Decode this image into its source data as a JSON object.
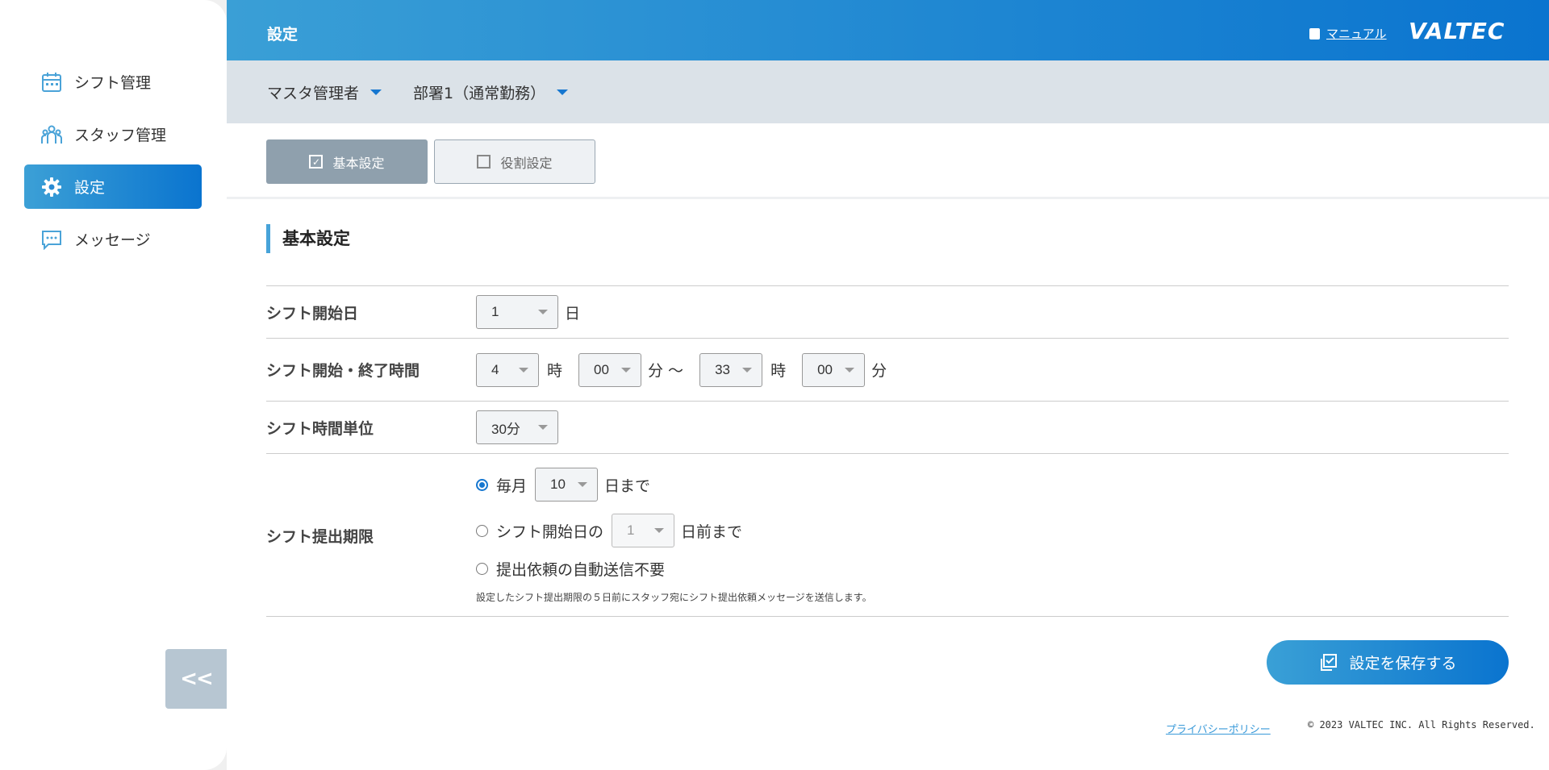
{
  "sidebar": {
    "items": [
      {
        "label": "シフト管理",
        "icon": "calendar-icon",
        "active": false
      },
      {
        "label": "スタッフ管理",
        "icon": "staff-icon",
        "active": false
      },
      {
        "label": "設定",
        "icon": "gear-icon",
        "active": true
      },
      {
        "label": "メッセージ",
        "icon": "message-icon",
        "active": false
      }
    ],
    "collapse_label": "<<"
  },
  "header": {
    "title": "設定",
    "manual_label": "マニュアル",
    "logo": "VALTEC"
  },
  "subheader": {
    "role_select": "マスタ管理者",
    "department_select": "部署1（通常勤務）"
  },
  "tabs": [
    {
      "label": "基本設定",
      "checked": true
    },
    {
      "label": "役割設定",
      "checked": false
    }
  ],
  "section": {
    "title": "基本設定"
  },
  "form": {
    "start_day": {
      "label": "シフト開始日",
      "value": "1",
      "unit": "日"
    },
    "time_range": {
      "label": "シフト開始・終了時間",
      "start_hour": "4",
      "hour_unit": "時",
      "start_min": "00",
      "min_unit_tilde": "分 〜",
      "end_hour": "33",
      "hour_unit2": "時",
      "end_min": "00",
      "min_unit": "分"
    },
    "time_unit": {
      "label": "シフト時間単位",
      "value": "30分"
    },
    "deadline": {
      "label": "シフト提出期限",
      "option1": {
        "prefix": "毎月",
        "value": "10",
        "suffix": "日まで",
        "selected": true
      },
      "option2": {
        "prefix": "シフト開始日の",
        "value": "1",
        "suffix": "日前まで",
        "selected": false
      },
      "option3": {
        "label": "提出依頼の自動送信不要",
        "selected": false
      },
      "note": "設定したシフト提出期限の５日前にスタッフ宛にシフト提出依頼メッセージを送信します。"
    }
  },
  "save_button": "設定を保存する",
  "footer": {
    "privacy": "プライバシーポリシー",
    "copyright": "© 2023 VALTEC INC. All Rights Reserved."
  }
}
